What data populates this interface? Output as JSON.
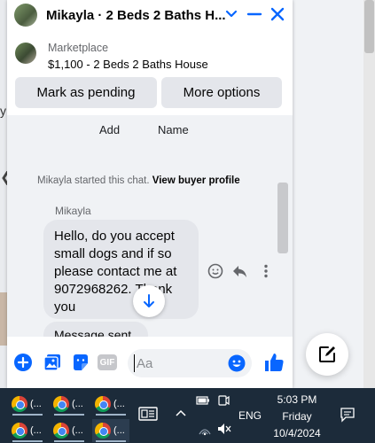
{
  "chat": {
    "title": "Mikayla · 2 Beds 2 Baths H...",
    "listing": {
      "label": "Marketplace",
      "price_title": "$1,100 - 2 Beds 2 Baths House"
    },
    "buttons": {
      "mark_pending": "Mark as pending",
      "more_options": "More options"
    },
    "columns": {
      "add": "Add",
      "name": "Name"
    },
    "started": {
      "text": "Mikayla started this chat.",
      "link": "View buyer profile"
    },
    "message": {
      "sender": "Mikayla",
      "lines": [
        "Hello, do you accept",
        "small dogs and if so",
        "please contact me at",
        "9072968262. Thank",
        "you"
      ],
      "next_partial": "Message sent"
    },
    "composer": {
      "placeholder": "Aa",
      "gif_label": "GIF"
    }
  },
  "background": {
    "fragment_y": "y"
  },
  "taskbar": {
    "apps": [
      {
        "label": "(..."
      },
      {
        "label": "(..."
      },
      {
        "label": "(..."
      },
      {
        "label": "(..."
      },
      {
        "label": "(..."
      },
      {
        "label": "(..."
      }
    ],
    "language": "ENG",
    "time": "5:03 PM",
    "day": "Friday",
    "date": "10/4/2024"
  },
  "colors": {
    "accent": "#0866ff",
    "taskbar": "#1c2b3a",
    "bubble": "#e4e6eb"
  }
}
